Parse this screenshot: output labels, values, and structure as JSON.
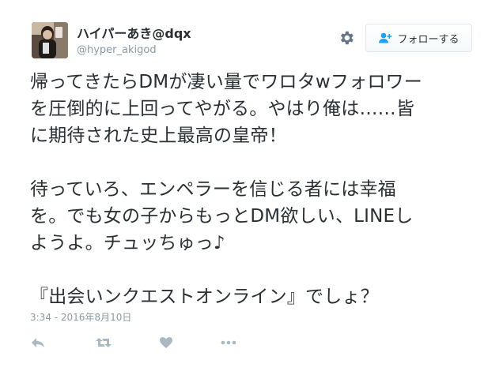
{
  "author": {
    "display_name": "ハイパーあき@dqx",
    "screen_name": "@hyper_akigod",
    "avatar_icon": "user-avatar-photo"
  },
  "header": {
    "settings_icon": "gear-icon",
    "follow_button_label": "フォローする",
    "follow_button_icon": "add-user-icon"
  },
  "tweet": {
    "paragraphs": [
      "帰ってきたらDMが凄い量でワロタwフォロワー\nを圧倒的に上回ってやがる。やはり俺は……皆\nに期待された史上最高の皇帝！",
      "待っていろ、エンペラーを信じる者には幸福\nを。でも女の子からもっとDM欲しい、LINEし\nようよ。チュッちゅっ♪",
      "『出会いンクエストオンライン』でしょ？"
    ],
    "timestamp": "3:34 - 2016年8月10日"
  },
  "actions": [
    {
      "name": "reply",
      "icon": "reply-icon"
    },
    {
      "name": "retweet",
      "icon": "retweet-icon"
    },
    {
      "name": "like",
      "icon": "heart-icon"
    },
    {
      "name": "more",
      "icon": "more-dots-icon"
    }
  ],
  "colors": {
    "text": "#292f33",
    "secondary_text": "#8899a6",
    "icon_gray": "#aab8c2",
    "follow_icon_blue": "#1da1f2",
    "border": "#e1e8ed"
  }
}
